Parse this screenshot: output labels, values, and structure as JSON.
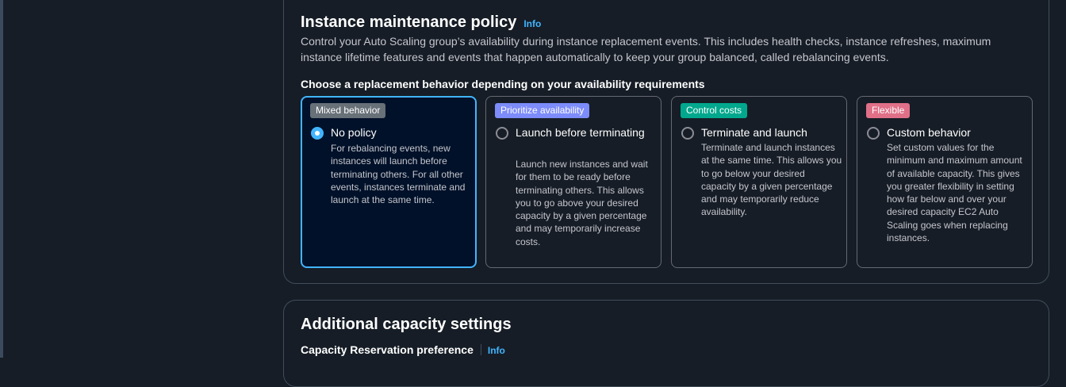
{
  "maintenance": {
    "title": "Instance maintenance policy",
    "info": "Info",
    "description": "Control your Auto Scaling group’s availability during instance replacement events. This includes health checks, instance refreshes, maximum instance lifetime features and events that happen automatically to keep your group balanced, called rebalancing events.",
    "subheading": "Choose a replacement behavior depending on your availability requirements",
    "options": [
      {
        "badge": "Mixed behavior",
        "badge_color": "#687078",
        "title": "No policy",
        "description": "For rebalancing events, new instances will launch before terminating others. For all other events, instances terminate and launch at the same time.",
        "selected": true
      },
      {
        "badge": "Prioritize availability",
        "badge_color": "#7d8cfa",
        "title": "Launch before terminating",
        "description": "Launch new instances and wait for them to be ready before terminating others. This allows you to go above your desired capacity by a given percentage and may temporarily increase costs.",
        "selected": false
      },
      {
        "badge": "Control costs",
        "badge_color": "#01a88d",
        "title": "Terminate and launch",
        "description": "Terminate and launch instances at the same time. This allows you to go below your desired capacity by a given percentage and may temporarily reduce availability.",
        "selected": false
      },
      {
        "badge": "Flexible",
        "badge_color": "#e07088",
        "title": "Custom behavior",
        "description": "Set custom values for the minimum and maximum amount of available capacity. This gives you greater flexibility in setting how far below and over your desired capacity EC2 Auto Scaling goes when replacing instances.",
        "selected": false
      }
    ]
  },
  "capacity": {
    "title": "Additional capacity settings",
    "reservation_label": "Capacity Reservation preference",
    "info": "Info"
  }
}
